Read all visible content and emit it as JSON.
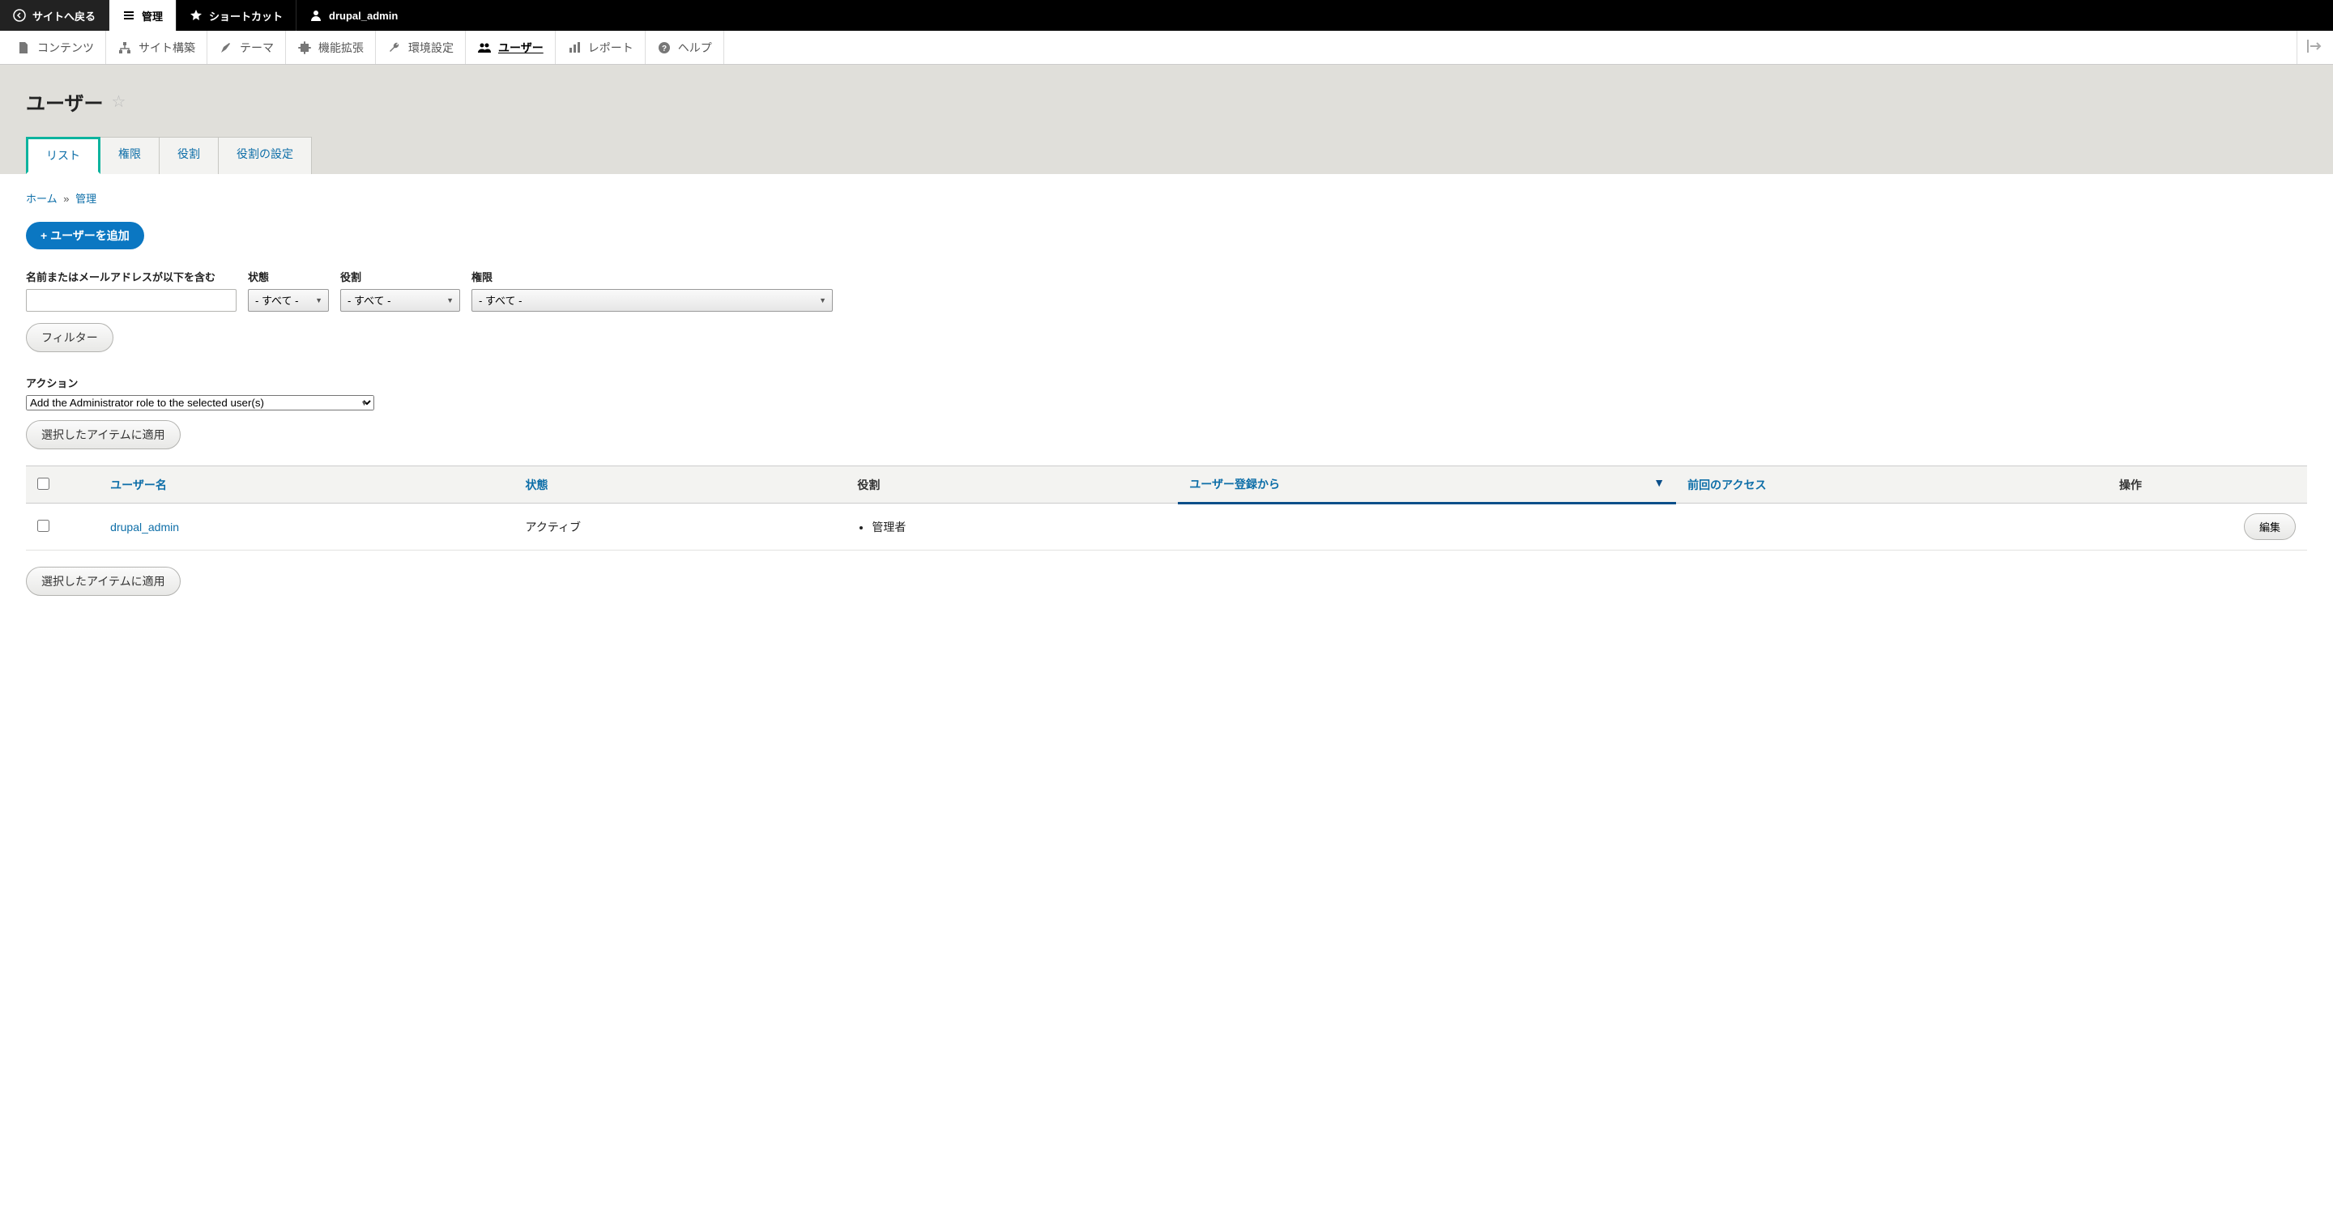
{
  "toolbar_top": {
    "back": "サイトへ戻る",
    "manage": "管理",
    "shortcuts": "ショートカット",
    "user": "drupal_admin"
  },
  "admin_menu": {
    "content": "コンテンツ",
    "structure": "サイト構築",
    "appearance": "テーマ",
    "extend": "機能拡張",
    "config": "環境設定",
    "people": "ユーザー",
    "reports": "レポート",
    "help": "ヘルプ"
  },
  "page_title": "ユーザー",
  "tabs": {
    "list": "リスト",
    "permissions": "権限",
    "roles": "役割",
    "role_settings": "役割の設定"
  },
  "breadcrumb": {
    "home": "ホーム",
    "admin": "管理"
  },
  "add_user_btn": "+ ユーザーを追加",
  "filters": {
    "name_label": "名前またはメールアドレスが以下を含む",
    "status_label": "状態",
    "status_value": "- すべて -",
    "role_label": "役割",
    "role_value": "- すべて -",
    "perm_label": "権限",
    "perm_value": "- すべて -",
    "filter_btn": "フィルター"
  },
  "action_section": {
    "label": "アクション",
    "value": "Add the Administrator role to the selected user(s)",
    "apply_btn": "選択したアイテムに適用"
  },
  "table": {
    "headers": {
      "username": "ユーザー名",
      "status": "状態",
      "roles": "役割",
      "member": "ユーザー登録から",
      "last_access": "前回のアクセス",
      "operations": "操作"
    },
    "rows": [
      {
        "username": "drupal_admin",
        "status": "アクティブ",
        "roles": [
          "管理者"
        ],
        "edit": "編集"
      }
    ]
  },
  "bottom_apply": "選択したアイテムに適用"
}
